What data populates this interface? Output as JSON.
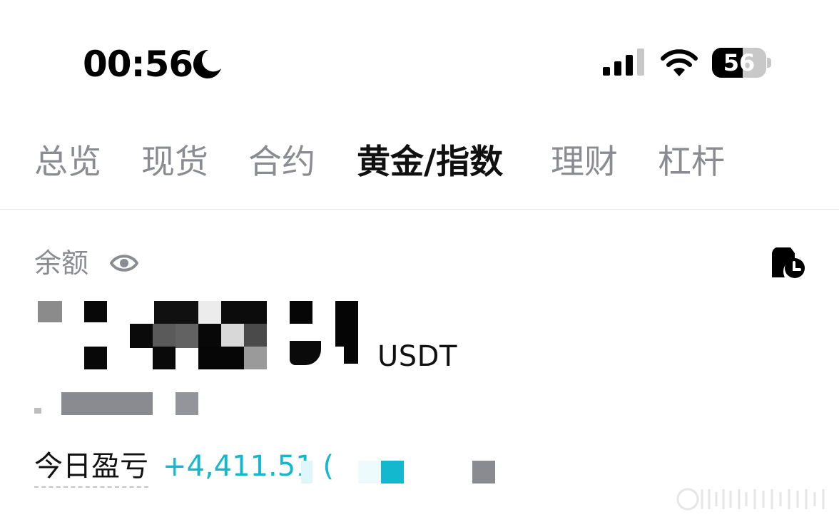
{
  "status_bar": {
    "time": "00:56",
    "icons": [
      "moon-icon",
      "signal-icon",
      "wifi-icon",
      "battery-icon"
    ],
    "battery_percent": "56",
    "battery_level": 0.56
  },
  "tabs": [
    {
      "label": "总览",
      "active": false
    },
    {
      "label": "现货",
      "active": false
    },
    {
      "label": "合约",
      "active": false
    },
    {
      "label": "黄金/指数",
      "active": true
    },
    {
      "label": "理财",
      "active": false
    },
    {
      "label": "杠杆",
      "active": false
    }
  ],
  "balance": {
    "label": "余额",
    "unit": "USDT",
    "eye_icon": "eye-icon",
    "history_icon": "history-icon"
  },
  "today_pnl": {
    "label": "今日盈亏",
    "value": "+4,411.51 (",
    "color": "#13b8cf"
  },
  "colors": {
    "tab_inactive": "#8a8c91",
    "tab_active": "#101010",
    "accent": "#13b8cf"
  }
}
